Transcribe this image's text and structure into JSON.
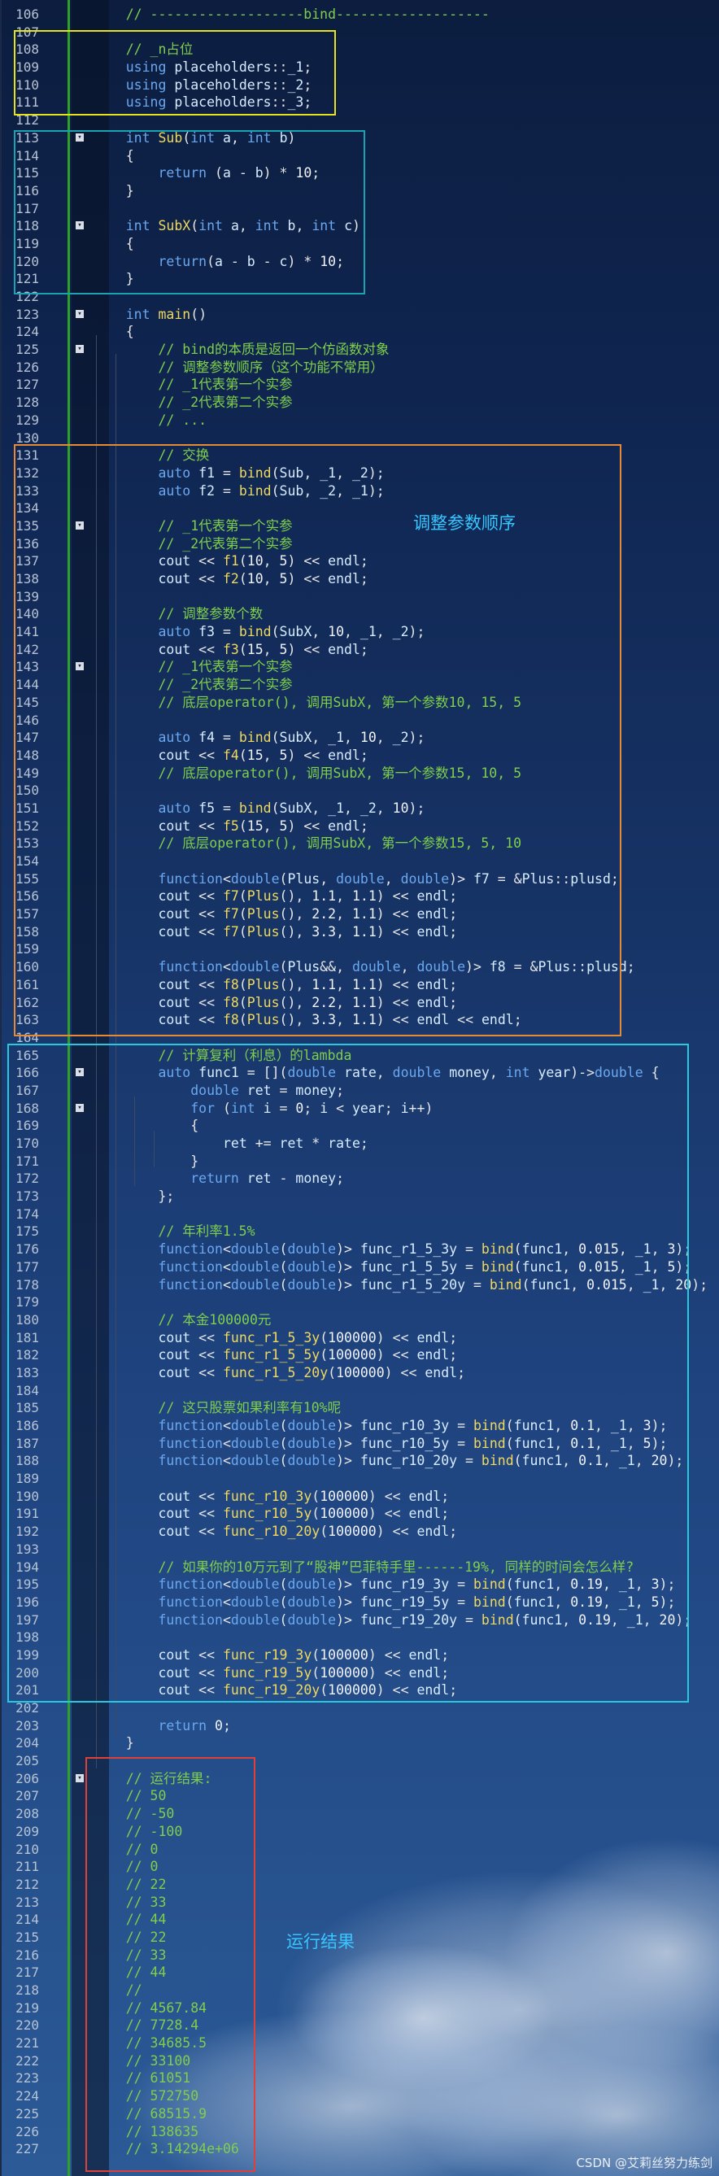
{
  "editor": {
    "lines": [
      {
        "n": "106",
        "t": "    // -------------------bind-------------------"
      },
      {
        "n": "107",
        "t": ""
      },
      {
        "n": "108",
        "t": "    // _n占位"
      },
      {
        "n": "109",
        "t": "    using placeholders::_1;"
      },
      {
        "n": "110",
        "t": "    using placeholders::_2;"
      },
      {
        "n": "111",
        "t": "    using placeholders::_3;"
      },
      {
        "n": "112",
        "t": ""
      },
      {
        "n": "113",
        "t": "    int Sub(int a, int b)",
        "fold": true
      },
      {
        "n": "114",
        "t": "    {"
      },
      {
        "n": "115",
        "t": "        return (a - b) * 10;"
      },
      {
        "n": "116",
        "t": "    }"
      },
      {
        "n": "117",
        "t": ""
      },
      {
        "n": "118",
        "t": "    int SubX(int a, int b, int c)",
        "fold": true
      },
      {
        "n": "119",
        "t": "    {"
      },
      {
        "n": "120",
        "t": "        return(a - b - c) * 10;"
      },
      {
        "n": "121",
        "t": "    }"
      },
      {
        "n": "122",
        "t": ""
      },
      {
        "n": "123",
        "t": "    int main()",
        "fold": true
      },
      {
        "n": "124",
        "t": "    {"
      },
      {
        "n": "125",
        "t": "        // bind的本质是返回一个仿函数对象",
        "fold": true
      },
      {
        "n": "126",
        "t": "        // 调整参数顺序（这个功能不常用）"
      },
      {
        "n": "127",
        "t": "        // _1代表第一个实参"
      },
      {
        "n": "128",
        "t": "        // _2代表第二个实参"
      },
      {
        "n": "129",
        "t": "        // ..."
      },
      {
        "n": "130",
        "t": ""
      },
      {
        "n": "131",
        "t": "        // 交换"
      },
      {
        "n": "132",
        "t": "        auto f1 = bind(Sub, _1, _2);"
      },
      {
        "n": "133",
        "t": "        auto f2 = bind(Sub, _2, _1);"
      },
      {
        "n": "134",
        "t": ""
      },
      {
        "n": "135",
        "t": "        // _1代表第一个实参",
        "fold": true
      },
      {
        "n": "136",
        "t": "        // _2代表第二个实参"
      },
      {
        "n": "137",
        "t": "        cout << f1(10, 5) << endl;"
      },
      {
        "n": "138",
        "t": "        cout << f2(10, 5) << endl;"
      },
      {
        "n": "139",
        "t": ""
      },
      {
        "n": "140",
        "t": "        // 调整参数个数"
      },
      {
        "n": "141",
        "t": "        auto f3 = bind(SubX, 10, _1, _2);"
      },
      {
        "n": "142",
        "t": "        cout << f3(15, 5) << endl;"
      },
      {
        "n": "143",
        "t": "        // _1代表第一个实参",
        "fold": true
      },
      {
        "n": "144",
        "t": "        // _2代表第二个实参"
      },
      {
        "n": "145",
        "t": "        // 底层operator(), 调用SubX, 第一个参数10, 15, 5"
      },
      {
        "n": "146",
        "t": ""
      },
      {
        "n": "147",
        "t": "        auto f4 = bind(SubX, _1, 10, _2);"
      },
      {
        "n": "148",
        "t": "        cout << f4(15, 5) << endl;"
      },
      {
        "n": "149",
        "t": "        // 底层operator(), 调用SubX, 第一个参数15, 10, 5"
      },
      {
        "n": "150",
        "t": ""
      },
      {
        "n": "151",
        "t": "        auto f5 = bind(SubX, _1, _2, 10);"
      },
      {
        "n": "152",
        "t": "        cout << f5(15, 5) << endl;"
      },
      {
        "n": "153",
        "t": "        // 底层operator(), 调用SubX, 第一个参数15, 5, 10"
      },
      {
        "n": "154",
        "t": ""
      },
      {
        "n": "155",
        "t": "        function<double(Plus, double, double)> f7 = &Plus::plusd;"
      },
      {
        "n": "156",
        "t": "        cout << f7(Plus(), 1.1, 1.1) << endl;"
      },
      {
        "n": "157",
        "t": "        cout << f7(Plus(), 2.2, 1.1) << endl;"
      },
      {
        "n": "158",
        "t": "        cout << f7(Plus(), 3.3, 1.1) << endl;"
      },
      {
        "n": "159",
        "t": ""
      },
      {
        "n": "160",
        "t": "        function<double(Plus&&, double, double)> f8 = &Plus::plusd;"
      },
      {
        "n": "161",
        "t": "        cout << f8(Plus(), 1.1, 1.1) << endl;"
      },
      {
        "n": "162",
        "t": "        cout << f8(Plus(), 2.2, 1.1) << endl;"
      },
      {
        "n": "163",
        "t": "        cout << f8(Plus(), 3.3, 1.1) << endl << endl;"
      },
      {
        "n": "164",
        "t": ""
      },
      {
        "n": "165",
        "t": "        // 计算复利（利息）的lambda"
      },
      {
        "n": "166",
        "t": "        auto func1 = [](double rate, double money, int year)->double {",
        "fold": true
      },
      {
        "n": "167",
        "t": "            double ret = money;"
      },
      {
        "n": "168",
        "t": "            for (int i = 0; i < year; i++)",
        "fold": true
      },
      {
        "n": "169",
        "t": "            {"
      },
      {
        "n": "170",
        "t": "                ret += ret * rate;"
      },
      {
        "n": "171",
        "t": "            }"
      },
      {
        "n": "172",
        "t": "            return ret - money;"
      },
      {
        "n": "173",
        "t": "        };"
      },
      {
        "n": "174",
        "t": ""
      },
      {
        "n": "175",
        "t": "        // 年利率1.5%"
      },
      {
        "n": "176",
        "t": "        function<double(double)> func_r1_5_3y = bind(func1, 0.015, _1, 3);"
      },
      {
        "n": "177",
        "t": "        function<double(double)> func_r1_5_5y = bind(func1, 0.015, _1, 5);"
      },
      {
        "n": "178",
        "t": "        function<double(double)> func_r1_5_20y = bind(func1, 0.015, _1, 20);"
      },
      {
        "n": "179",
        "t": ""
      },
      {
        "n": "180",
        "t": "        // 本金100000元"
      },
      {
        "n": "181",
        "t": "        cout << func_r1_5_3y(100000) << endl;"
      },
      {
        "n": "182",
        "t": "        cout << func_r1_5_5y(100000) << endl;"
      },
      {
        "n": "183",
        "t": "        cout << func_r1_5_20y(100000) << endl;"
      },
      {
        "n": "184",
        "t": ""
      },
      {
        "n": "185",
        "t": "        // 这只股票如果利率有10%呢"
      },
      {
        "n": "186",
        "t": "        function<double(double)> func_r10_3y = bind(func1, 0.1, _1, 3);"
      },
      {
        "n": "187",
        "t": "        function<double(double)> func_r10_5y = bind(func1, 0.1, _1, 5);"
      },
      {
        "n": "188",
        "t": "        function<double(double)> func_r10_20y = bind(func1, 0.1, _1, 20);"
      },
      {
        "n": "189",
        "t": ""
      },
      {
        "n": "190",
        "t": "        cout << func_r10_3y(100000) << endl;"
      },
      {
        "n": "191",
        "t": "        cout << func_r10_5y(100000) << endl;"
      },
      {
        "n": "192",
        "t": "        cout << func_r10_20y(100000) << endl;"
      },
      {
        "n": "193",
        "t": ""
      },
      {
        "n": "194",
        "t": "        // 如果你的10万元到了“股神”巴菲特手里------19%, 同样的时间会怎么样?"
      },
      {
        "n": "195",
        "t": "        function<double(double)> func_r19_3y = bind(func1, 0.19, _1, 3);"
      },
      {
        "n": "196",
        "t": "        function<double(double)> func_r19_5y = bind(func1, 0.19, _1, 5);"
      },
      {
        "n": "197",
        "t": "        function<double(double)> func_r19_20y = bind(func1, 0.19, _1, 20);"
      },
      {
        "n": "198",
        "t": ""
      },
      {
        "n": "199",
        "t": "        cout << func_r19_3y(100000) << endl;"
      },
      {
        "n": "200",
        "t": "        cout << func_r19_5y(100000) << endl;"
      },
      {
        "n": "201",
        "t": "        cout << func_r19_20y(100000) << endl;"
      },
      {
        "n": "202",
        "t": ""
      },
      {
        "n": "203",
        "t": "        return 0;"
      },
      {
        "n": "204",
        "t": "    }"
      },
      {
        "n": "205",
        "t": ""
      },
      {
        "n": "206",
        "t": "    // 运行结果:",
        "fold": true
      },
      {
        "n": "207",
        "t": "    // 50"
      },
      {
        "n": "208",
        "t": "    // -50"
      },
      {
        "n": "209",
        "t": "    // -100"
      },
      {
        "n": "210",
        "t": "    // 0"
      },
      {
        "n": "211",
        "t": "    // 0"
      },
      {
        "n": "212",
        "t": "    // 22"
      },
      {
        "n": "213",
        "t": "    // 33"
      },
      {
        "n": "214",
        "t": "    // 44"
      },
      {
        "n": "215",
        "t": "    // 22"
      },
      {
        "n": "216",
        "t": "    // 33"
      },
      {
        "n": "217",
        "t": "    // 44"
      },
      {
        "n": "218",
        "t": "    //"
      },
      {
        "n": "219",
        "t": "    // 4567.84"
      },
      {
        "n": "220",
        "t": "    // 7728.4"
      },
      {
        "n": "221",
        "t": "    // 34685.5"
      },
      {
        "n": "222",
        "t": "    // 33100"
      },
      {
        "n": "223",
        "t": "    // 61051"
      },
      {
        "n": "224",
        "t": "    // 572750"
      },
      {
        "n": "225",
        "t": "    // 68515.9"
      },
      {
        "n": "226",
        "t": "    // 138635"
      },
      {
        "n": "227",
        "t": "    // 3.14294e+06"
      }
    ]
  },
  "annotations": {
    "adjust_order_label": "调整参数顺序",
    "run_result_label": "运行结果"
  },
  "colors": {
    "yellow_box": "#e8e21b",
    "teal_box": "#1aa3b0",
    "orange_box": "#e88a35",
    "cyan_box": "#27c9e0",
    "red_box": "#e0403a",
    "label_color": "#37c6ff"
  },
  "watermark": "CSDN @艾莉丝努力练剑"
}
